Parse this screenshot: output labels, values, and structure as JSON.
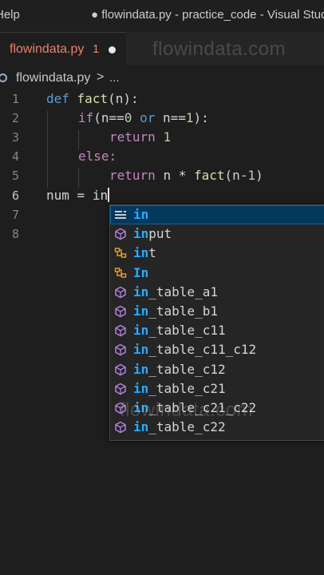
{
  "titlebar": {
    "menu_help": "Help",
    "window_title": "● flowindata.py - practice_code - Visual Studio Code"
  },
  "tab": {
    "filename": "flowindata.py",
    "problem_count": "1"
  },
  "watermark": "flowindata.com",
  "breadcrumb": {
    "file": "flowindata.py",
    "separator": ">",
    "more": "..."
  },
  "editor": {
    "line_numbers": [
      "1",
      "2",
      "3",
      "4",
      "5",
      "6",
      "7",
      "8"
    ],
    "lines": {
      "l1": {
        "kw": "def",
        "fn": "fact",
        "rest": "(n):",
        "param": "n"
      },
      "l2": {
        "kw": "if",
        "text_a": "(n==",
        "num0": "0",
        "or": "or",
        "text_b": " n==",
        "num1": "1",
        "text_c": "):"
      },
      "l3": {
        "kw": "return",
        "num": "1"
      },
      "l4": {
        "kw": "else:"
      },
      "l5": {
        "kw": "return",
        "var": "n",
        "mid": " * ",
        "fn": "fact",
        "args": "(n-",
        "num": "1",
        "close": ")"
      },
      "l6": {
        "var": "num",
        "mid": " = ",
        "typed": "in"
      }
    }
  },
  "suggestions": {
    "items": [
      {
        "match": "in",
        "rest": "",
        "kind": "keyword"
      },
      {
        "match": "in",
        "rest": "put",
        "kind": "function"
      },
      {
        "match": "in",
        "rest": "t",
        "kind": "class"
      },
      {
        "match": "In",
        "rest": "",
        "kind": "class"
      },
      {
        "match": "in",
        "rest": "_table_a1",
        "kind": "variable"
      },
      {
        "match": "in",
        "rest": "_table_b1",
        "kind": "variable"
      },
      {
        "match": "in",
        "rest": "_table_c11",
        "kind": "variable"
      },
      {
        "match": "in",
        "rest": "_table_c11_c12",
        "kind": "variable"
      },
      {
        "match": "in",
        "rest": "_table_c12",
        "kind": "variable"
      },
      {
        "match": "in",
        "rest": "_table_c21",
        "kind": "variable"
      },
      {
        "match": "in",
        "rest": "_table_c21_c22",
        "kind": "variable"
      },
      {
        "match": "in",
        "rest": "_table_c22",
        "kind": "variable"
      }
    ]
  },
  "colors": {
    "editor_bg": "#1e1e1e",
    "keyword": "#569cd6",
    "control_keyword": "#c586c0",
    "function": "#dcdcaa",
    "variable": "#9cdcfe",
    "number": "#b5cea8",
    "match_highlight": "#2aaaff",
    "tab_modified": "#e9806e",
    "suggest_icon": "#b180d7",
    "class_icon": "#ee9d28"
  }
}
